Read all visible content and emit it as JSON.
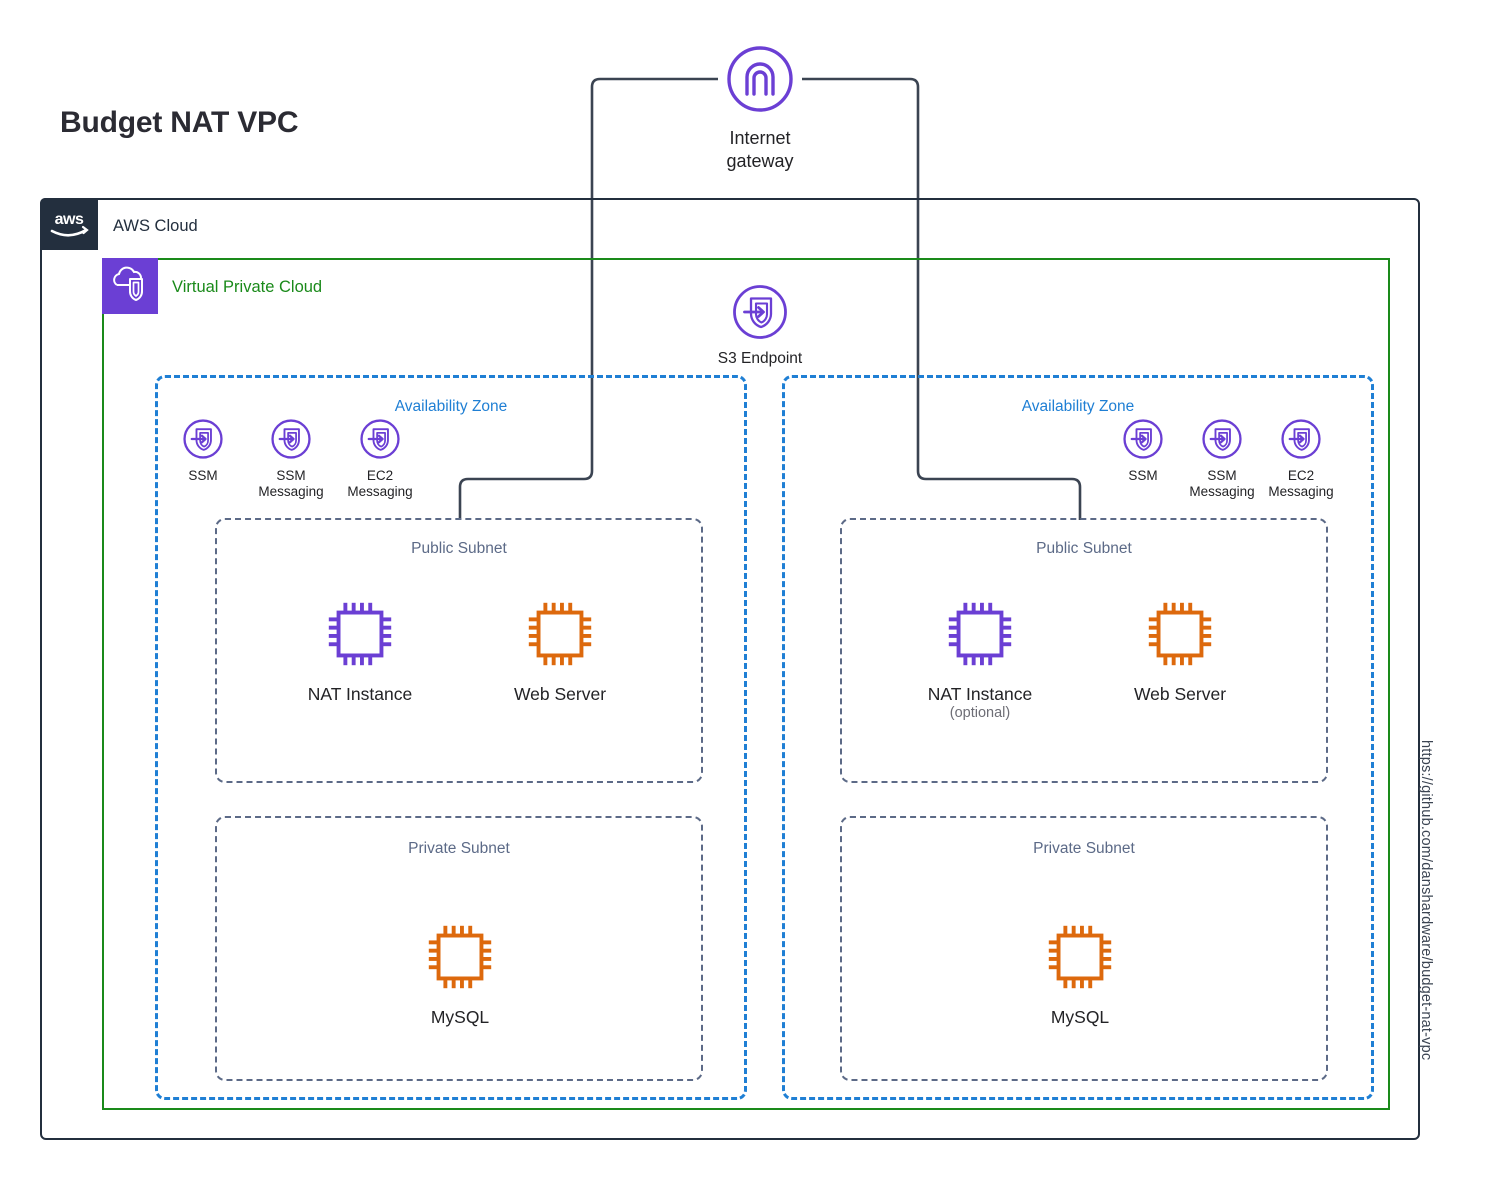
{
  "title": "Budget NAT VPC",
  "footer_url": "https://github.com/danshardware/budget-nat-vpc",
  "cloud": {
    "label": "AWS Cloud",
    "logo_icon": "aws-logo-icon",
    "border_color": "#232f3e"
  },
  "vpc": {
    "label": "Virtual Private Cloud",
    "icon": "vpc-cloud-shield-icon",
    "border_color": "#1a8a1a",
    "badge_color": "#6b3fd4"
  },
  "internet_gateway": {
    "label_line1": "Internet",
    "label_line2": "gateway",
    "icon": "internet-gateway-icon",
    "color": "#6b3fd4"
  },
  "s3_endpoint": {
    "label": "S3 Endpoint",
    "icon": "vpc-endpoint-icon",
    "color": "#6b3fd4"
  },
  "availability_zones": [
    {
      "label": "Availability Zone",
      "border_color": "#1f7fd4",
      "endpoints": [
        {
          "name": "SSM",
          "line1": "SSM",
          "line2": "",
          "icon": "vpc-endpoint-icon"
        },
        {
          "name": "SSM Messaging",
          "line1": "SSM",
          "line2": "Messaging",
          "icon": "vpc-endpoint-icon"
        },
        {
          "name": "EC2 Messaging",
          "line1": "EC2",
          "line2": "Messaging",
          "icon": "vpc-endpoint-icon"
        }
      ],
      "public_subnet": {
        "label": "Public Subnet",
        "instances": [
          {
            "name": "NAT Instance",
            "label": "NAT Instance",
            "sublabel": "",
            "icon": "ec2-instance-icon",
            "color": "#6b3fd4"
          },
          {
            "name": "Web Server",
            "label": "Web Server",
            "sublabel": "",
            "icon": "ec2-instance-icon",
            "color": "#dd690d"
          }
        ]
      },
      "private_subnet": {
        "label": "Private Subnet",
        "instances": [
          {
            "name": "MySQL",
            "label": "MySQL",
            "sublabel": "",
            "icon": "ec2-instance-icon",
            "color": "#dd690d"
          }
        ]
      }
    },
    {
      "label": "Availability Zone",
      "border_color": "#1f7fd4",
      "endpoints": [
        {
          "name": "SSM",
          "line1": "SSM",
          "line2": "",
          "icon": "vpc-endpoint-icon"
        },
        {
          "name": "SSM Messaging",
          "line1": "SSM",
          "line2": "Messaging",
          "icon": "vpc-endpoint-icon"
        },
        {
          "name": "EC2 Messaging",
          "line1": "EC2",
          "line2": "Messaging",
          "icon": "vpc-endpoint-icon"
        }
      ],
      "public_subnet": {
        "label": "Public Subnet",
        "instances": [
          {
            "name": "NAT Instance",
            "label": "NAT Instance",
            "sublabel": "(optional)",
            "icon": "ec2-instance-icon",
            "color": "#6b3fd4"
          },
          {
            "name": "Web Server",
            "label": "Web Server",
            "sublabel": "",
            "icon": "ec2-instance-icon",
            "color": "#dd690d"
          }
        ]
      },
      "private_subnet": {
        "label": "Private Subnet",
        "instances": [
          {
            "name": "MySQL",
            "label": "MySQL",
            "sublabel": "",
            "icon": "ec2-instance-icon",
            "color": "#dd690d"
          }
        ]
      }
    }
  ],
  "subnet_label_color": "#5c6a87",
  "connector_color": "#3b4452"
}
